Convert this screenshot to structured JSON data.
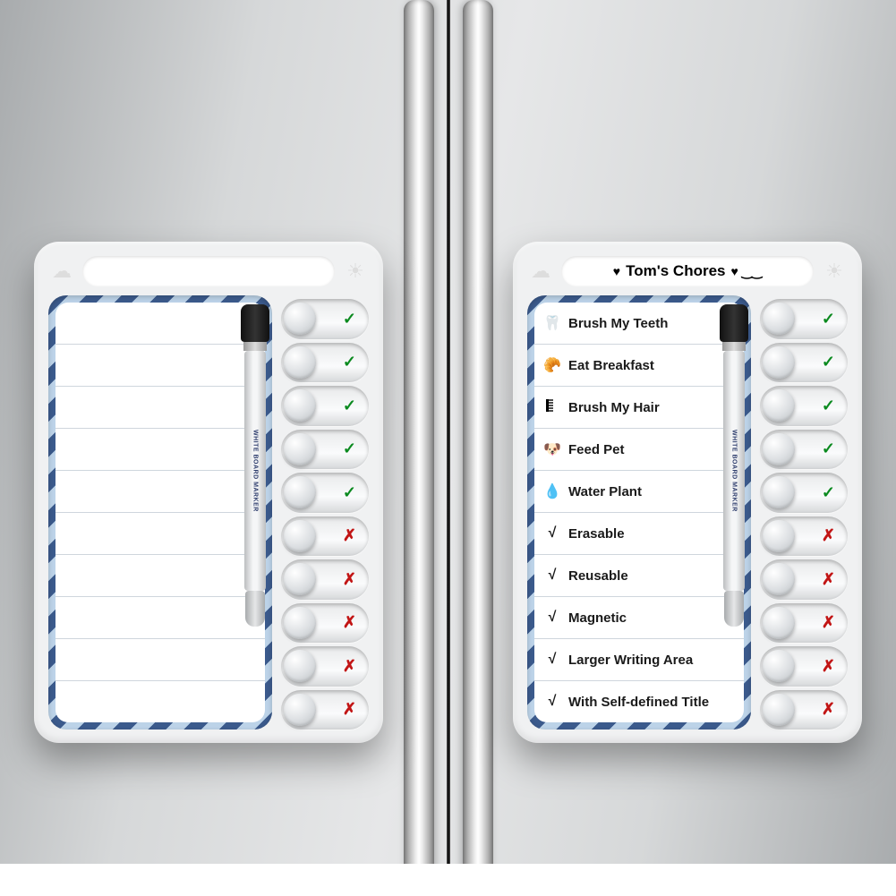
{
  "left_board": {
    "title": "",
    "rows": [
      {
        "icon": "",
        "text": ""
      },
      {
        "icon": "",
        "text": ""
      },
      {
        "icon": "",
        "text": ""
      },
      {
        "icon": "",
        "text": ""
      },
      {
        "icon": "",
        "text": ""
      },
      {
        "icon": "",
        "text": ""
      },
      {
        "icon": "",
        "text": ""
      },
      {
        "icon": "",
        "text": ""
      },
      {
        "icon": "",
        "text": ""
      },
      {
        "icon": "",
        "text": ""
      }
    ],
    "sliders": [
      "check",
      "check",
      "check",
      "check",
      "check",
      "cross",
      "cross",
      "cross",
      "cross",
      "cross"
    ]
  },
  "right_board": {
    "title": "Tom's Chores",
    "title_decor_left": "♥",
    "title_decor_right": "♥ ‿‿",
    "rows": [
      {
        "icon": "🦷",
        "text": "Brush My Teeth"
      },
      {
        "icon": "🥐",
        "text": "Eat Breakfast"
      },
      {
        "icon": "comb",
        "text": "Brush My Hair"
      },
      {
        "icon": "🐶",
        "text": "Feed Pet"
      },
      {
        "icon": "💧",
        "text": "Water Plant"
      },
      {
        "icon": "√",
        "text": "Erasable"
      },
      {
        "icon": "√",
        "text": "Reusable"
      },
      {
        "icon": "√",
        "text": "Magnetic"
      },
      {
        "icon": "√",
        "text": "Larger Writing Area"
      },
      {
        "icon": "√",
        "text": "With Self-defined Title"
      }
    ],
    "sliders": [
      "check",
      "check",
      "check",
      "check",
      "check",
      "cross",
      "cross",
      "cross",
      "cross",
      "cross"
    ]
  },
  "marker_label": "WHITE BOARD MARKER"
}
